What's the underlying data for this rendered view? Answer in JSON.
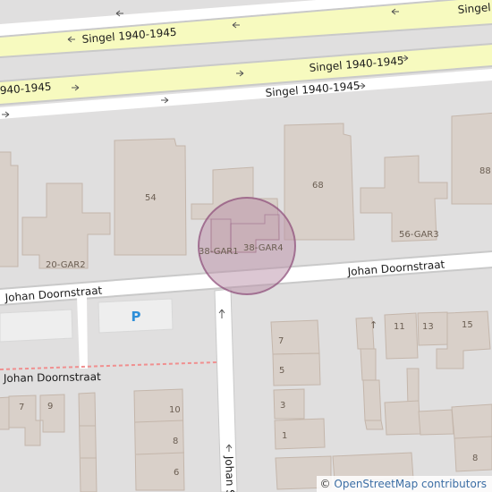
{
  "colors": {
    "background": "#e0dfdf",
    "building": "#d9d0c9",
    "building_stroke": "#c4b6ab",
    "trunk_road": "#f7fabf",
    "road": "#ffffff",
    "road_casing": "#c9c9c9",
    "parking": "#eeeeee",
    "parking_symbol": "#2f8fd8",
    "boundary": "#f08f8f",
    "highlight_fill": "#b98fa8",
    "highlight_stroke": "#8c4a77",
    "label": "#1a1a1a",
    "house_number": "#6b5e52"
  },
  "streets": {
    "singel_top": "Singel",
    "singel_1": "Singel 1940-1945",
    "singel_2": "Singel 1940-1945",
    "singel_3": "Singel 1940-1945",
    "singel_4": "Singel 1940-1945",
    "johan_left": "Johan Doornstraat",
    "johan_right": "Johan Doornstraat",
    "johan_lower": "Johan Doornstraat",
    "johan_vertical": "Johan S"
  },
  "house_numbers": {
    "n54": "54",
    "n68": "68",
    "n88": "88",
    "g20": "20-GAR2",
    "g38a": "38-GAR1",
    "g38b": "38-GAR4",
    "g56": "56-GAR3",
    "n7a": "7",
    "n9": "9",
    "n10": "10",
    "n8a": "8",
    "n6": "6",
    "n7b": "7",
    "n5": "5",
    "n3": "3",
    "n1": "1",
    "n11": "11",
    "n13": "13",
    "n15": "15",
    "n8b": "8"
  },
  "parking_label": "P",
  "attribution": {
    "prefix": "©",
    "link": "OpenStreetMap contributors"
  }
}
